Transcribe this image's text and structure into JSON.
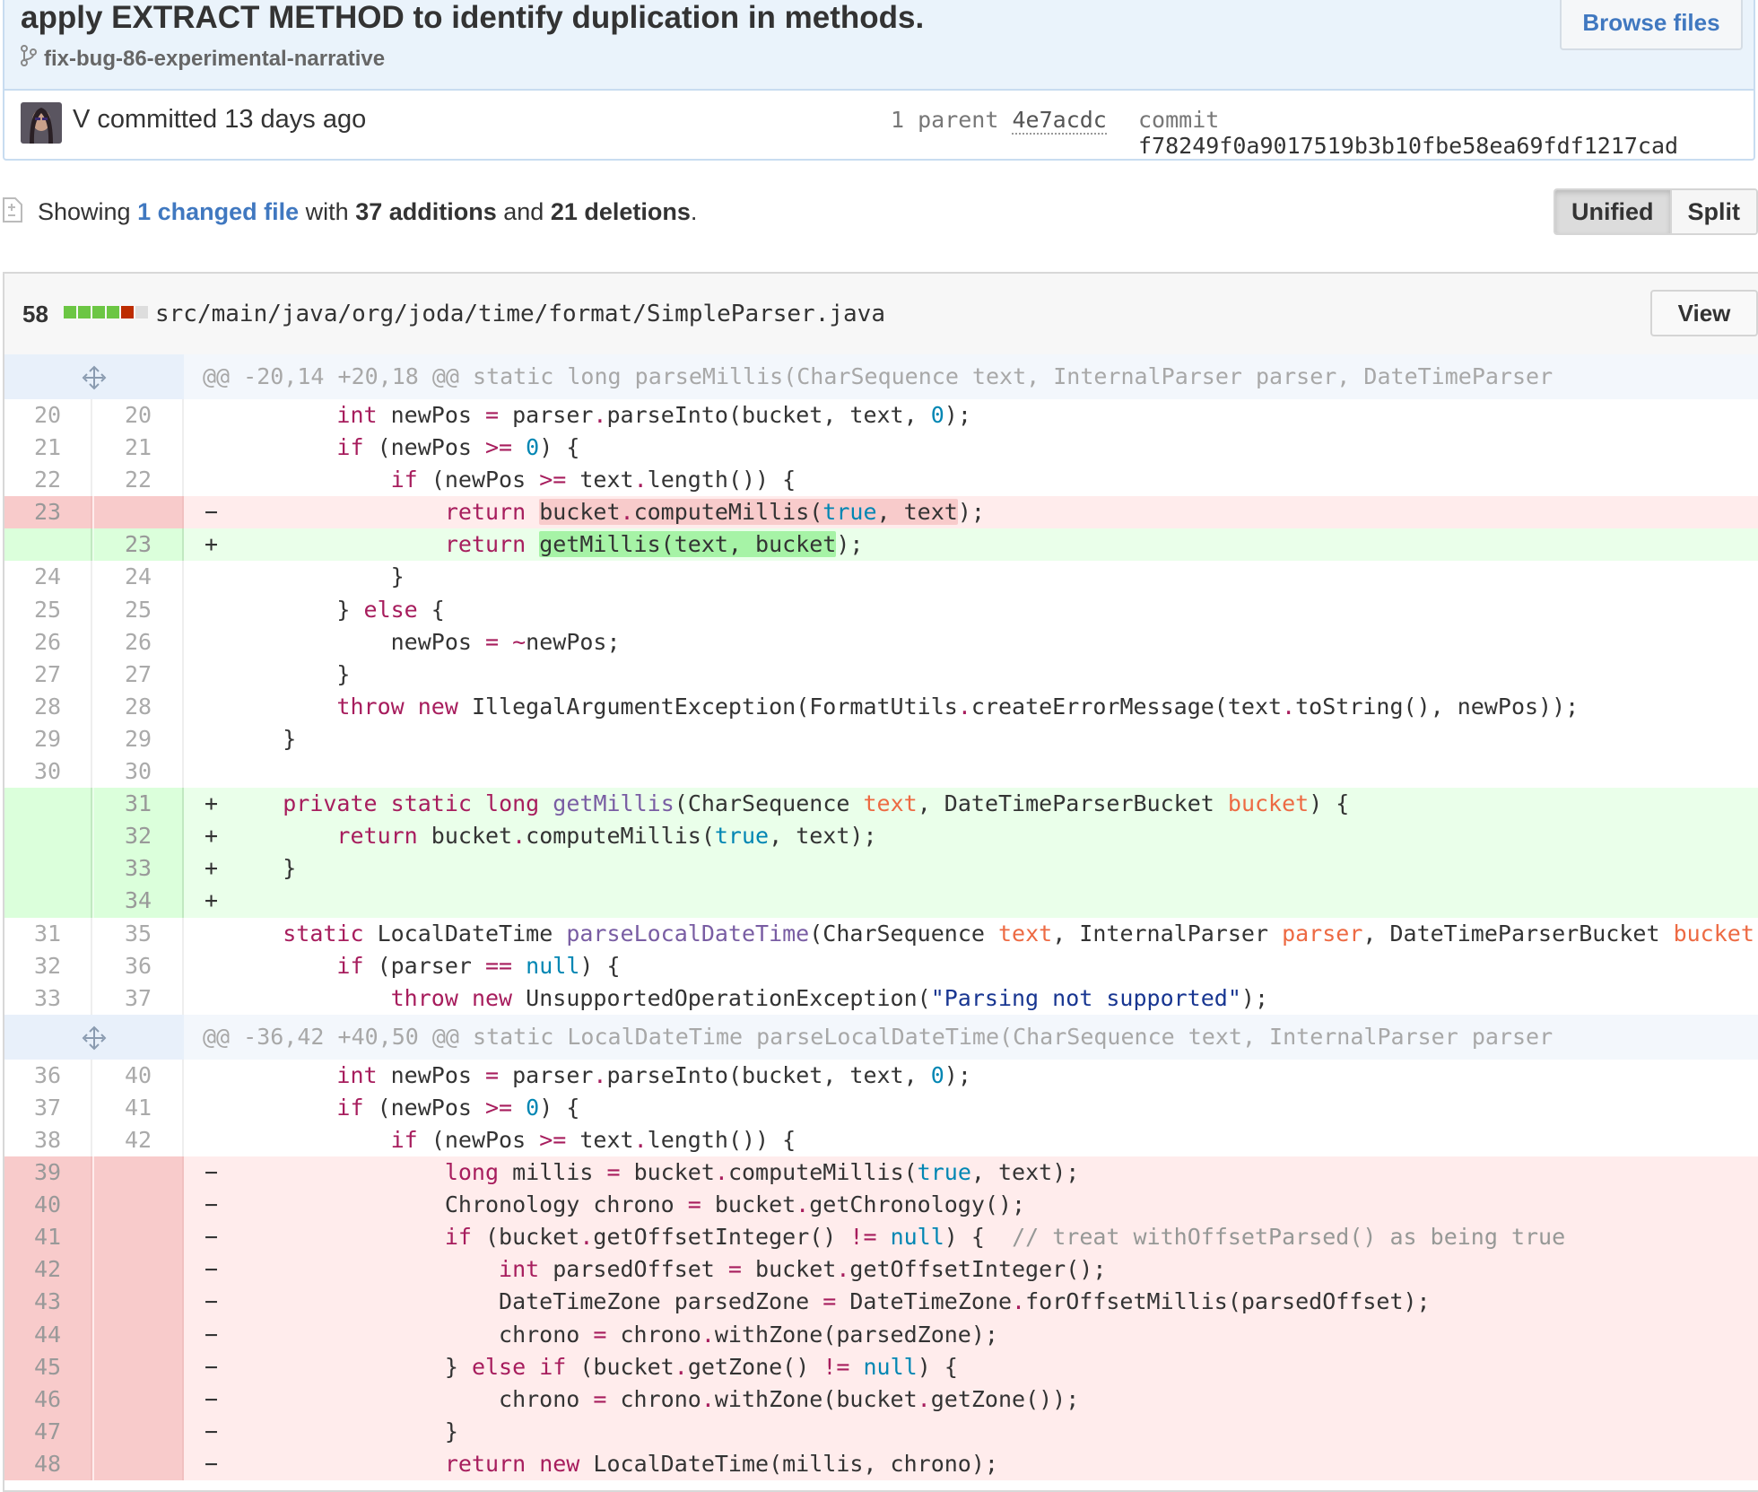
{
  "commit": {
    "title": "apply EXTRACT METHOD to identify duplication in methods.",
    "branch": "fix-bug-86-experimental-narrative",
    "browse_label": "Browse files",
    "author_line": "V committed 13 days ago",
    "parent_label": "1 parent",
    "parent_sha": "4e7acdc",
    "commit_label": "commit",
    "commit_sha": "f78249f0a9017519b3b10fbe58ea69fdf1217cad"
  },
  "toc": {
    "showing": "Showing",
    "changed_link": "1 changed file",
    "with": "with",
    "additions": "37 additions",
    "and": "and",
    "deletions": "21 deletions",
    "period": "."
  },
  "view_toggle": {
    "unified": "Unified",
    "split": "Split"
  },
  "file": {
    "count": "58",
    "path": "src/main/java/org/joda/time/format/SimpleParser.java",
    "view_label": "View",
    "stat_colors": [
      "#6cc644",
      "#6cc644",
      "#6cc644",
      "#6cc644",
      "#bd2c00",
      "#dddddd"
    ]
  },
  "colors": {
    "link": "#4078c0",
    "deletion_bg": "#ffecec",
    "addition_bg": "#eaffea"
  },
  "diff": [
    {
      "type": "hunk",
      "text": "@@ -20,14 +20,18 @@ static long parseMillis(CharSequence text, InternalParser parser, DateTimeParser"
    },
    {
      "type": "ctx",
      "old": "20",
      "new": "20",
      "html": "        <span class=\"kw\">int</span> newPos <span class=\"kw\">=</span> parser<span class=\"kw\">.</span>parseInto(bucket, text, <span class=\"nb\">0</span>);"
    },
    {
      "type": "ctx",
      "old": "21",
      "new": "21",
      "html": "        <span class=\"kw\">if</span> (newPos <span class=\"kw\">&gt;=</span> <span class=\"nb\">0</span>) {"
    },
    {
      "type": "ctx",
      "old": "22",
      "new": "22",
      "html": "            <span class=\"kw\">if</span> (newPos <span class=\"kw\">&gt;=</span> text<span class=\"kw\">.</span>length()) {"
    },
    {
      "type": "del",
      "old": "23",
      "new": "",
      "html": "                <span class=\"kw\">return</span> <span class=\"hl-del\">bucket<span class=\"kw\">.</span>computeMillis(<span class=\"nb\">true</span>, text</span>);"
    },
    {
      "type": "add",
      "old": "",
      "new": "23",
      "html": "                <span class=\"kw\">return</span> <span class=\"hl-add\">getMillis(text, bucket</span>);"
    },
    {
      "type": "ctx",
      "old": "24",
      "new": "24",
      "html": "            }"
    },
    {
      "type": "ctx",
      "old": "25",
      "new": "25",
      "html": "        } <span class=\"kw\">else</span> {"
    },
    {
      "type": "ctx",
      "old": "26",
      "new": "26",
      "html": "            newPos <span class=\"kw\">=</span> <span class=\"kw\">~</span>newPos;"
    },
    {
      "type": "ctx",
      "old": "27",
      "new": "27",
      "html": "        }"
    },
    {
      "type": "ctx",
      "old": "28",
      "new": "28",
      "html": "        <span class=\"kw\">throw</span> <span class=\"kw\">new</span> IllegalArgumentException(FormatUtils<span class=\"kw\">.</span>createErrorMessage(text<span class=\"kw\">.</span>toString(), newPos));"
    },
    {
      "type": "ctx",
      "old": "29",
      "new": "29",
      "html": "    }"
    },
    {
      "type": "ctx",
      "old": "30",
      "new": "30",
      "html": ""
    },
    {
      "type": "add",
      "old": "",
      "new": "31",
      "html": "    <span class=\"kw\">private</span> <span class=\"kw\">static</span> <span class=\"kw\">long</span> <span class=\"fn\">getMillis</span>(CharSequence <span class=\"pr\">text</span>, DateTimeParserBucket <span class=\"pr\">bucket</span>) {"
    },
    {
      "type": "add",
      "old": "",
      "new": "32",
      "html": "        <span class=\"kw\">return</span> bucket<span class=\"kw\">.</span>computeMillis(<span class=\"nb\">true</span>, text);"
    },
    {
      "type": "add",
      "old": "",
      "new": "33",
      "html": "    }"
    },
    {
      "type": "add",
      "old": "",
      "new": "34",
      "html": ""
    },
    {
      "type": "ctx",
      "old": "31",
      "new": "35",
      "html": "    <span class=\"kw\">static</span> LocalDateTime <span class=\"fn\">parseLocalDateTime</span>(CharSequence <span class=\"pr\">text</span>, InternalParser <span class=\"pr\">parser</span>, DateTimeParserBucket <span class=\"pr\">bucket</span>) {"
    },
    {
      "type": "ctx",
      "old": "32",
      "new": "36",
      "html": "        <span class=\"kw\">if</span> (parser <span class=\"kw\">==</span> <span class=\"nb\">null</span>) {"
    },
    {
      "type": "ctx",
      "old": "33",
      "new": "37",
      "html": "            <span class=\"kw\">throw</span> <span class=\"kw\">new</span> UnsupportedOperationException(<span class=\"st\">\"Parsing not supported\"</span>);"
    },
    {
      "type": "hunk",
      "text": "@@ -36,42 +40,50 @@ static LocalDateTime parseLocalDateTime(CharSequence text, InternalParser parser"
    },
    {
      "type": "ctx",
      "old": "36",
      "new": "40",
      "html": "        <span class=\"kw\">int</span> newPos <span class=\"kw\">=</span> parser<span class=\"kw\">.</span>parseInto(bucket, text, <span class=\"nb\">0</span>);"
    },
    {
      "type": "ctx",
      "old": "37",
      "new": "41",
      "html": "        <span class=\"kw\">if</span> (newPos <span class=\"kw\">&gt;=</span> <span class=\"nb\">0</span>) {"
    },
    {
      "type": "ctx",
      "old": "38",
      "new": "42",
      "html": "            <span class=\"kw\">if</span> (newPos <span class=\"kw\">&gt;=</span> text<span class=\"kw\">.</span>length()) {"
    },
    {
      "type": "del",
      "old": "39",
      "new": "",
      "html": "                <span class=\"kw\">long</span> millis <span class=\"kw\">=</span> bucket<span class=\"kw\">.</span>computeMillis(<span class=\"nb\">true</span>, text);"
    },
    {
      "type": "del",
      "old": "40",
      "new": "",
      "html": "                Chronology chrono <span class=\"kw\">=</span> bucket<span class=\"kw\">.</span>getChronology();"
    },
    {
      "type": "del",
      "old": "41",
      "new": "",
      "html": "                <span class=\"kw\">if</span> (bucket<span class=\"kw\">.</span>getOffsetInteger() <span class=\"kw\">!=</span> <span class=\"nb\">null</span>) {  <span class=\"cm\">// treat withOffsetParsed() as being true</span>"
    },
    {
      "type": "del",
      "old": "42",
      "new": "",
      "html": "                    <span class=\"kw\">int</span> parsedOffset <span class=\"kw\">=</span> bucket<span class=\"kw\">.</span>getOffsetInteger();"
    },
    {
      "type": "del",
      "old": "43",
      "new": "",
      "html": "                    DateTimeZone parsedZone <span class=\"kw\">=</span> DateTimeZone<span class=\"kw\">.</span>forOffsetMillis(parsedOffset);"
    },
    {
      "type": "del",
      "old": "44",
      "new": "",
      "html": "                    chrono <span class=\"kw\">=</span> chrono<span class=\"kw\">.</span>withZone(parsedZone);"
    },
    {
      "type": "del",
      "old": "45",
      "new": "",
      "html": "                } <span class=\"kw\">else</span> <span class=\"kw\">if</span> (bucket<span class=\"kw\">.</span>getZone() <span class=\"kw\">!=</span> <span class=\"nb\">null</span>) {"
    },
    {
      "type": "del",
      "old": "46",
      "new": "",
      "html": "                    chrono <span class=\"kw\">=</span> chrono<span class=\"kw\">.</span>withZone(bucket<span class=\"kw\">.</span>getZone());"
    },
    {
      "type": "del",
      "old": "47",
      "new": "",
      "html": "                }"
    },
    {
      "type": "del",
      "old": "48",
      "new": "",
      "html": "                <span class=\"kw\">return</span> <span class=\"kw\">new</span> LocalDateTime(millis, chrono);"
    }
  ]
}
